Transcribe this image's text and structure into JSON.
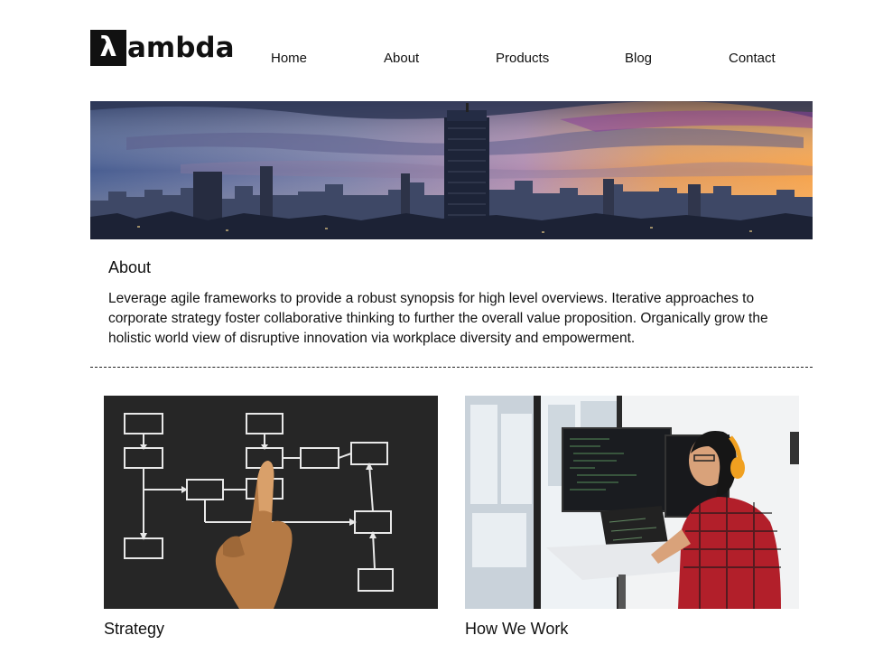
{
  "brand": {
    "logo_glyph": "λ",
    "logo_text": "ambda"
  },
  "nav": {
    "items": [
      "Home",
      "About",
      "Products",
      "Blog",
      "Contact"
    ]
  },
  "about": {
    "title": "About",
    "body": "Leverage agile frameworks to provide a robust synopsis for high level overviews. Iterative approaches to corporate strategy foster collaborative thinking to further the overall value proposition. Organically grow the holistic world view of disruptive innovation via workplace diversity and empowerment."
  },
  "cards": [
    {
      "title": "Strategy"
    },
    {
      "title": "How We Work"
    }
  ],
  "colors": {
    "text": "#111111",
    "sky_purple": "#7b6aa8",
    "sky_orange": "#f0a14a",
    "board": "#2a2a2a",
    "shirt_red": "#b0202a",
    "headphone": "#f0a020"
  }
}
